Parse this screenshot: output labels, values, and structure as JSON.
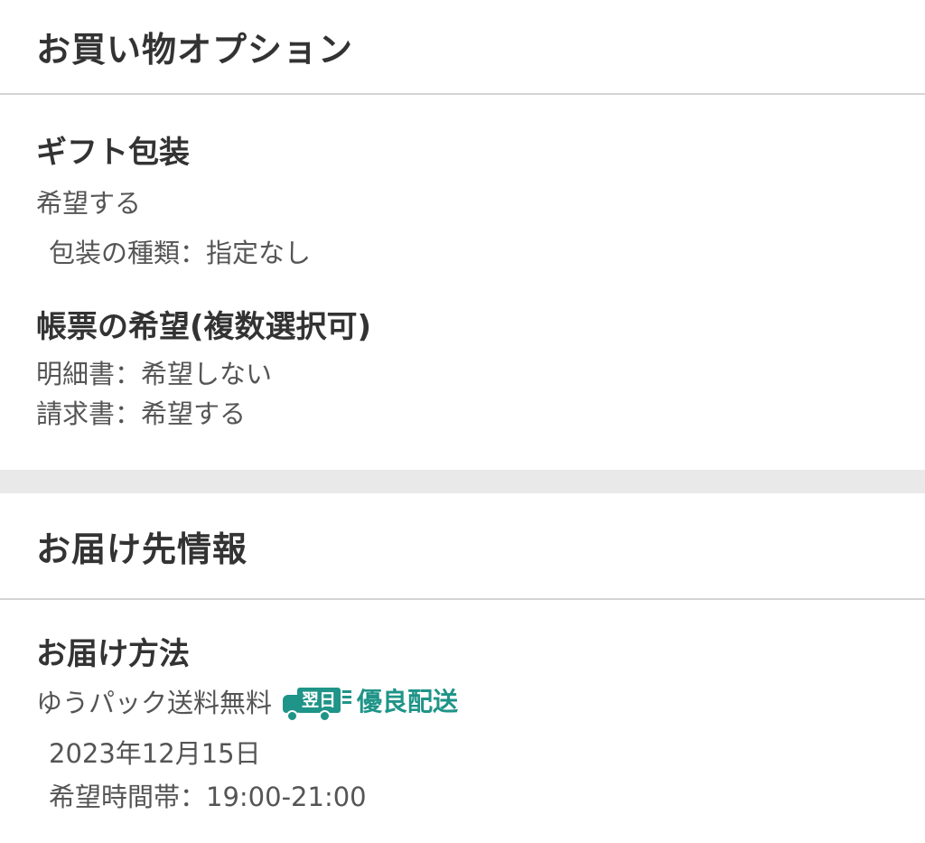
{
  "shopping_options": {
    "title": "お買い物オプション",
    "gift_wrap": {
      "title": "ギフト包装",
      "value": "希望する",
      "type_line": "包装の種類：指定なし"
    },
    "invoice": {
      "title": "帳票の希望(複数選択可)",
      "statement_line": "明細書：希望しない",
      "bill_line": "請求書：希望する"
    }
  },
  "delivery_info": {
    "title": "お届け先情報",
    "method": {
      "title": "お届け方法",
      "carrier": "ゆうパック送料無料",
      "badge_truck_label": "翌日",
      "badge_text": "優良配送",
      "badge_icon": "truck-icon",
      "badge_color": "#1f9488",
      "date": "2023年12月15日",
      "time_slot": "希望時間帯：19:00-21:00"
    }
  }
}
